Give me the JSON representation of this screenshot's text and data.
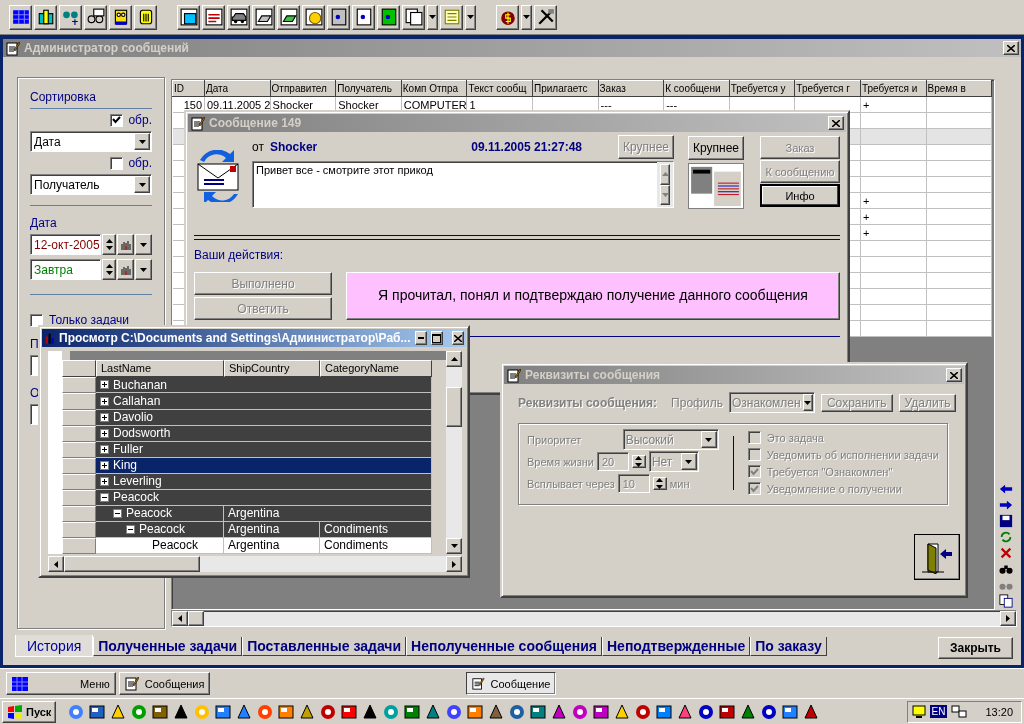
{
  "main_window": {
    "title": "Администратор сообщений"
  },
  "sort": {
    "title": "Сортировка",
    "fields": [
      {
        "value": "Дата",
        "reverse_label": "обр.",
        "reverse_checked": true
      },
      {
        "value": "Получатель",
        "reverse_label": "обр.",
        "reverse_checked": false
      }
    ]
  },
  "date_filter": {
    "title": "Дата",
    "from": "12-окт-2005",
    "to": "Завтра"
  },
  "only_tasks": {
    "label": "Только задачи",
    "checked": false
  },
  "covered_labels": [
    "П",
    "О"
  ],
  "table": {
    "columns": [
      "ID",
      "Дата",
      "Отправител",
      "Получатель",
      "Комп Отпра",
      "Текст сообщ",
      "Прилагаетс",
      "Заказ",
      "К сообщени",
      "Требуется у",
      "Требуется г",
      "Требуется и",
      "Время в"
    ],
    "rows": [
      {
        "selected": false,
        "cells": [
          "150",
          "09.11.2005 2",
          "Shocker",
          "Shocker",
          "COMPUTER",
          "1",
          null,
          "---",
          "---",
          null,
          null,
          "+",
          null
        ]
      },
      {
        "selected": false,
        "cells": [
          null,
          null,
          null,
          null,
          null,
          null,
          null,
          null,
          null,
          null,
          null,
          null,
          null
        ]
      },
      {
        "selected": true,
        "cells": [
          null,
          null,
          null,
          null,
          null,
          null,
          null,
          null,
          null,
          null,
          null,
          null,
          null
        ]
      },
      {
        "selected": false,
        "cells": [
          null,
          null,
          null,
          null,
          null,
          null,
          null,
          null,
          null,
          null,
          null,
          null,
          null
        ]
      },
      {
        "selected": false,
        "cells": [
          null,
          null,
          null,
          null,
          null,
          null,
          null,
          null,
          null,
          null,
          null,
          null,
          null
        ]
      },
      {
        "selected": false,
        "cells": [
          null,
          null,
          null,
          null,
          null,
          null,
          null,
          null,
          null,
          null,
          null,
          null,
          null
        ]
      },
      {
        "selected": false,
        "cells": [
          null,
          null,
          null,
          null,
          null,
          null,
          null,
          null,
          null,
          null,
          null,
          "+",
          null
        ]
      },
      {
        "selected": false,
        "cells": [
          null,
          null,
          null,
          null,
          null,
          null,
          null,
          null,
          null,
          null,
          null,
          "+",
          null
        ]
      },
      {
        "selected": false,
        "cells": [
          null,
          null,
          null,
          null,
          null,
          null,
          null,
          null,
          null,
          null,
          null,
          "+",
          null
        ]
      },
      {
        "selected": false,
        "cells": [
          null,
          null,
          null,
          null,
          null,
          null,
          null,
          null,
          null,
          null,
          null,
          null,
          null
        ]
      },
      {
        "selected": false,
        "cells": [
          null,
          null,
          null,
          null,
          null,
          null,
          null,
          null,
          null,
          null,
          null,
          null,
          null
        ]
      },
      {
        "selected": false,
        "cells": [
          null,
          null,
          null,
          null,
          null,
          null,
          null,
          null,
          null,
          null,
          null,
          null,
          null
        ]
      },
      {
        "selected": false,
        "cells": [
          null,
          null,
          null,
          null,
          null,
          null,
          null,
          null,
          null,
          null,
          null,
          null,
          null
        ]
      },
      {
        "selected": false,
        "cells": [
          null,
          null,
          null,
          null,
          null,
          null,
          null,
          null,
          null,
          null,
          null,
          null,
          null
        ]
      },
      {
        "selected": false,
        "cells": [
          null,
          null,
          null,
          null,
          null,
          null,
          null,
          null,
          null,
          null,
          null,
          null,
          null
        ]
      }
    ]
  },
  "tabs": [
    {
      "label": "История",
      "selected": true
    },
    {
      "label": "Полученные задачи",
      "selected": false
    },
    {
      "label": "Поставленные задачи",
      "selected": false
    },
    {
      "label": "Неполученные сообщения",
      "selected": false
    },
    {
      "label": "Неподтвержденные",
      "selected": false
    },
    {
      "label": "По заказу",
      "selected": false
    }
  ],
  "close_button": "Закрыть",
  "message_dialog": {
    "title": "Сообщение 149",
    "from_label": "от",
    "sender": "Shocker",
    "datetime": "09.11.2005 21:27:48",
    "text": "Привет все - смотрите этот прикод",
    "enlarge_buttons": [
      {
        "label": "Крупнее",
        "disabled": true
      },
      {
        "label": "Крупнее",
        "disabled": false
      }
    ],
    "side_buttons": [
      {
        "label": "Заказ",
        "disabled": true
      },
      {
        "label": "К сообщению",
        "disabled": true
      },
      {
        "label": "Инфо",
        "disabled": false
      }
    ],
    "actions_label": "Ваши действия:",
    "action_buttons": [
      {
        "label": "Выполнено",
        "disabled": true
      },
      {
        "label": "Ответить",
        "disabled": true
      }
    ],
    "confirm_button": "Я прочитал, понял и подтверждаю получение данного сообщения"
  },
  "grid_window": {
    "title": "Просмотр C:\\Documents and Settings\\Администратор\\Раб...",
    "columns": [
      "LastName",
      "ShipCountry",
      "CategoryName"
    ],
    "rows": [
      {
        "kind": "group",
        "cells": [
          "Buchanan"
        ],
        "expanded": false,
        "selected": false
      },
      {
        "kind": "group",
        "cells": [
          "Callahan"
        ],
        "expanded": false,
        "selected": false
      },
      {
        "kind": "group",
        "cells": [
          "Davolio"
        ],
        "expanded": false,
        "selected": false
      },
      {
        "kind": "group",
        "cells": [
          "Dodsworth"
        ],
        "expanded": false,
        "selected": false
      },
      {
        "kind": "group",
        "cells": [
          "Fuller"
        ],
        "expanded": false,
        "selected": false
      },
      {
        "kind": "group",
        "cells": [
          "King"
        ],
        "expanded": false,
        "selected": true
      },
      {
        "kind": "group",
        "cells": [
          "Leverling"
        ],
        "expanded": false,
        "selected": false
      },
      {
        "kind": "group",
        "cells": [
          "Peacock"
        ],
        "expanded": true,
        "selected": false,
        "children": [
          {
            "kind": "group",
            "cells": [
              "Peacock",
              "Argentina"
            ],
            "expanded": true,
            "selected": false,
            "children": [
              {
                "kind": "group",
                "cells": [
                  "Peacock",
                  "Argentina",
                  "Condiments"
                ],
                "expanded": true,
                "selected": false,
                "children": [
                  {
                    "kind": "record",
                    "cells": [
                      "Peacock",
                      "Argentina",
                      "Condiments"
                    ],
                    "selected": false
                  }
                ]
              }
            ]
          }
        ]
      }
    ]
  },
  "requisites_dialog": {
    "title": "Реквизиты сообщения",
    "disabled": true,
    "heading": "Реквизиты сообщения:",
    "profile_label": "Профиль",
    "profile": "Ознакомлен",
    "save_button": "Сохранить",
    "delete_button": "Удалить",
    "priority_label": "Приоритет",
    "priority": "Высокий",
    "lifetime_label": "Время жизни",
    "lifetime": "20",
    "lifetime_unit": "Нет",
    "popup_label": "Всплывает через",
    "popup": "10",
    "popup_unit": "мин",
    "options": [
      {
        "label": "Это задача",
        "checked": false
      },
      {
        "label": "Уведомить об исполнении задачи",
        "checked": false
      },
      {
        "label": "Требуется \"Ознакомлен\"",
        "checked": true
      },
      {
        "label": "Уведомление о получении",
        "checked": true
      }
    ]
  },
  "mdi_bar": {
    "buttons": [
      "Меню",
      "Сообщения"
    ],
    "task_button": "Сообщение"
  },
  "taskbar": {
    "start": "Пуск",
    "language": "EN",
    "clock": "13:20"
  }
}
